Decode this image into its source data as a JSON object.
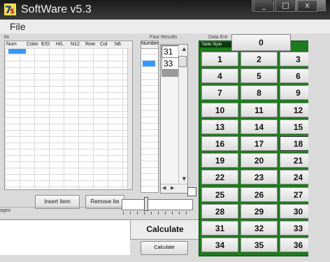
{
  "window": {
    "title": "SoftWare v5.3",
    "close_glyph": "x",
    "min_glyph": "_",
    "max_glyph": "□"
  },
  "menu": {
    "file": "File"
  },
  "groupbox_titles": {
    "left": "lts",
    "past_results": "Past Results",
    "data_entry": "Data Ent",
    "messages": "ages"
  },
  "grid": {
    "columns": [
      "Num",
      "Color",
      "E/O",
      "H/L",
      "N12",
      "Row",
      "Col",
      "N6"
    ]
  },
  "buttons": {
    "insert": "Insert Item",
    "remove": "Remove Ite"
  },
  "past_results": {
    "header": "Number",
    "values": [
      "31",
      "33"
    ]
  },
  "calculate": {
    "big": "Calculate",
    "small": "Calculate"
  },
  "table": {
    "header": "Table Style",
    "zero": "0",
    "rows": [
      [
        "1",
        "2",
        "3"
      ],
      [
        "4",
        "5",
        "6"
      ],
      [
        "7",
        "8",
        "9"
      ],
      [
        "10",
        "11",
        "12"
      ],
      [
        "13",
        "14",
        "15"
      ],
      [
        "16",
        "17",
        "18"
      ],
      [
        "19",
        "20",
        "21"
      ],
      [
        "22",
        "23",
        "24"
      ],
      [
        "25",
        "26",
        "27"
      ],
      [
        "28",
        "29",
        "30"
      ],
      [
        "31",
        "32",
        "33"
      ],
      [
        "34",
        "35",
        "36"
      ]
    ],
    "selected": "18"
  },
  "colors": {
    "board": "#1e7a1e",
    "selection": "#3399ff",
    "titlebar": "#2a2a2a"
  }
}
